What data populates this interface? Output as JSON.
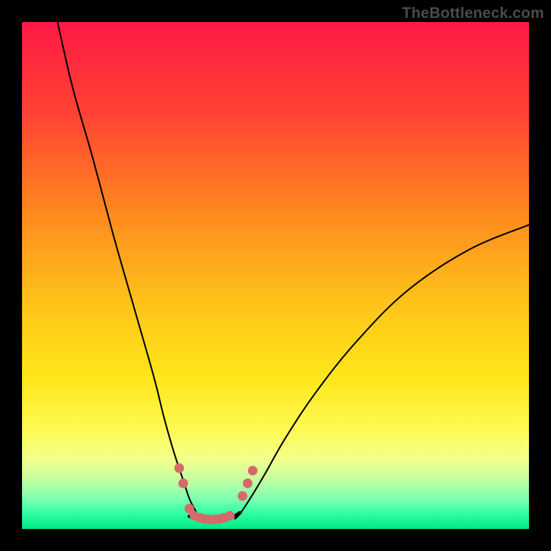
{
  "watermark": "TheBottleneck.com",
  "chart_data": {
    "type": "line",
    "title": "",
    "xlabel": "",
    "ylabel": "",
    "xlim": [
      0,
      100
    ],
    "ylim": [
      0,
      100
    ],
    "grid": false,
    "legend": false,
    "gradient_stops": [
      {
        "offset": 0.0,
        "color": "#ff1a45"
      },
      {
        "offset": 0.18,
        "color": "#ff4233"
      },
      {
        "offset": 0.38,
        "color": "#ff8a1f"
      },
      {
        "offset": 0.55,
        "color": "#ffc21a"
      },
      {
        "offset": 0.7,
        "color": "#ffe61a"
      },
      {
        "offset": 0.8,
        "color": "#fff94f"
      },
      {
        "offset": 0.86,
        "color": "#f4ff8a"
      },
      {
        "offset": 0.9,
        "color": "#c8ffa0"
      },
      {
        "offset": 0.94,
        "color": "#7fffb0"
      },
      {
        "offset": 0.97,
        "color": "#2effa0"
      },
      {
        "offset": 1.0,
        "color": "#00e885"
      }
    ],
    "series": [
      {
        "name": "left-arm",
        "x": [
          7,
          10,
          14,
          18,
          22,
          26,
          28,
          30,
          32,
          33,
          34,
          35,
          36
        ],
        "y": [
          100,
          87,
          73,
          58,
          44,
          30,
          22,
          15,
          9,
          6,
          4,
          2.5,
          2
        ]
      },
      {
        "name": "right-arm",
        "x": [
          42,
          43,
          45,
          48,
          52,
          58,
          66,
          76,
          88,
          100
        ],
        "y": [
          2,
          3,
          6,
          11,
          18,
          27,
          37,
          47,
          55,
          60
        ]
      },
      {
        "name": "valley-floor",
        "x": [
          33,
          34,
          35,
          36,
          37,
          38,
          39,
          40,
          41,
          42,
          43
        ],
        "y": [
          2.5,
          2.2,
          2.0,
          1.9,
          1.85,
          1.85,
          1.9,
          2.0,
          2.2,
          2.6,
          3.2
        ]
      }
    ],
    "markers": {
      "name": "highlighted-points",
      "color": "#d66a6a",
      "radius": 7,
      "points": [
        {
          "x": 31.0,
          "y": 12.0
        },
        {
          "x": 31.8,
          "y": 9.0
        },
        {
          "x": 33.0,
          "y": 4.0
        },
        {
          "x": 34.0,
          "y": 2.6
        },
        {
          "x": 35.0,
          "y": 2.2
        },
        {
          "x": 36.0,
          "y": 2.0
        },
        {
          "x": 37.0,
          "y": 1.9
        },
        {
          "x": 38.0,
          "y": 1.9
        },
        {
          "x": 39.0,
          "y": 2.0
        },
        {
          "x": 40.0,
          "y": 2.2
        },
        {
          "x": 41.0,
          "y": 2.6
        },
        {
          "x": 43.5,
          "y": 6.5
        },
        {
          "x": 44.5,
          "y": 9.0
        },
        {
          "x": 45.5,
          "y": 11.5
        }
      ]
    }
  }
}
